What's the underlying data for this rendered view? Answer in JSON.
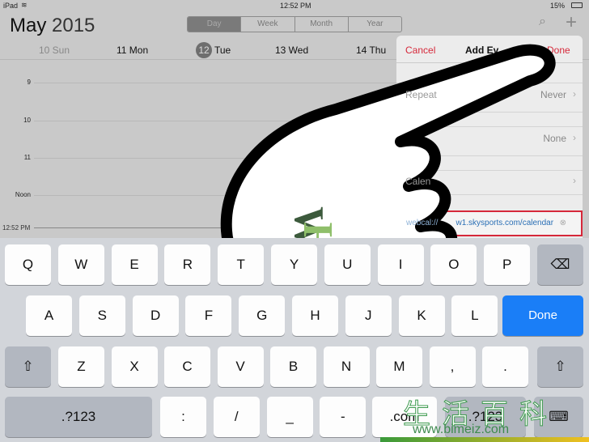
{
  "status": {
    "device": "iPad",
    "time": "12:52 PM",
    "battery": "15%"
  },
  "header": {
    "month": "May",
    "year": "2015",
    "views": [
      "Day",
      "Week",
      "Month",
      "Year"
    ],
    "selected_view": "Day"
  },
  "days": [
    {
      "num": "10",
      "label": "10 Sun"
    },
    {
      "num": "11",
      "label": "11 Mon"
    },
    {
      "num": "12",
      "label": "Tue"
    },
    {
      "num": "13",
      "label": "13 Wed"
    },
    {
      "num": "14",
      "label": "14 Thu"
    }
  ],
  "hours": [
    "9",
    "10",
    "11",
    "Noon"
  ],
  "now": "12:52 PM",
  "panel": {
    "cancel": "Cancel",
    "title": "Add Ev",
    "done": "Done",
    "repeat_label": "Repeat",
    "repeat_value": "Never",
    "alert_value": "None",
    "calendar_label": "Calen",
    "url_prefix": "webcal://",
    "url_value": "w1.skysports.com/calendar"
  },
  "keyboard": {
    "row1": [
      "Q",
      "W",
      "E",
      "R",
      "T",
      "Y",
      "U",
      "I",
      "O",
      "P"
    ],
    "row2": [
      "A",
      "S",
      "D",
      "F",
      "G",
      "H",
      "J",
      "K",
      "L"
    ],
    "done": "Done",
    "row3": [
      "Z",
      "X",
      "C",
      "V",
      "B",
      "N",
      "M",
      ",",
      "."
    ],
    "row4": [
      ":",
      "/",
      "_",
      "-"
    ],
    "numbers": ".?123",
    "dotcom": ".com"
  },
  "watermark": {
    "logo_cn": "生活百科",
    "site": "www.bimeiz.com"
  },
  "colors": {
    "accent_red": "#d6283a",
    "done_blue": "#1a7ef7"
  }
}
